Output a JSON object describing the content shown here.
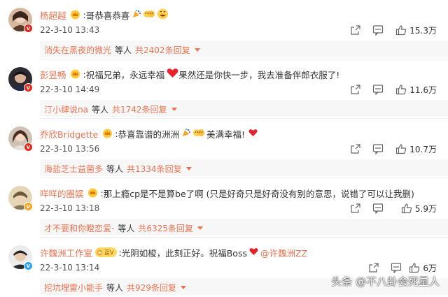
{
  "comments": [
    {
      "username": "杨超越",
      "text": "哥恭喜恭喜",
      "emojis": [
        "party-popper-emoji",
        "cheer-emoji",
        "grin-emoji"
      ],
      "time": "22-3-10 13:43",
      "likes": "15.3万",
      "reply_user": "消失在黑夜的微光",
      "deng": "等人",
      "reply_count": "共2402条回复",
      "avatar_badge": "red"
    },
    {
      "username": "彭昱畅",
      "text_before": "祝福兄弟，永远幸福",
      "text_after": "果然还是你快一步，我去准备伴郎衣服了!",
      "time": "22-3-10 14:49",
      "likes": "11.6万",
      "reply_user": "汀小肆说na",
      "deng": "等人",
      "reply_count": "共1742条回复",
      "avatar_badge": "red"
    },
    {
      "username": "乔欣Bridgette",
      "text_before": "恭喜靠谱的洲洲",
      "text_after": "美满幸福!",
      "time": "22-3-10 13:56",
      "likes": "10.7万",
      "reply_user": "海盐芝士益菌多",
      "deng": "等人",
      "reply_count": "共1334条回复",
      "avatar_badge": "red"
    },
    {
      "username": "咩咩的圈娱",
      "text": "那上瘾cp是不是算be了啊 (只是好奇只是好奇没有别的意思，说错了可以让我删)",
      "time": "22-3-10 13:18",
      "likes": "5.9万",
      "reply_user": "才不要和你瞪恋爱-",
      "deng": "等人",
      "reply_count": "共6325条回复",
      "avatar_badge": "gold"
    },
    {
      "username": "许魏洲工作室",
      "vip_label": "蓝V",
      "text": "光阴如梭，此刻正好。祝福Boss",
      "mention": "@许魏洲ZZ",
      "time": "22-3-10 13:14",
      "likes": "6万",
      "reply_user": "挖坑埋雷小能手",
      "deng": "等人",
      "reply_count": "共929条回复",
      "avatar_badge": "blue"
    }
  ],
  "icons": {
    "share": "share-icon",
    "comment": "comment-icon",
    "like": "thumbs-up-icon",
    "vip": "crown-badge-icon"
  },
  "colors": {
    "username": "#eb7350",
    "link": "#eb7350",
    "text": "#333333",
    "reply_bg": "#f7f7f7",
    "heart": "#e8212a"
  },
  "watermark": "头条 @不八卦会死星人"
}
